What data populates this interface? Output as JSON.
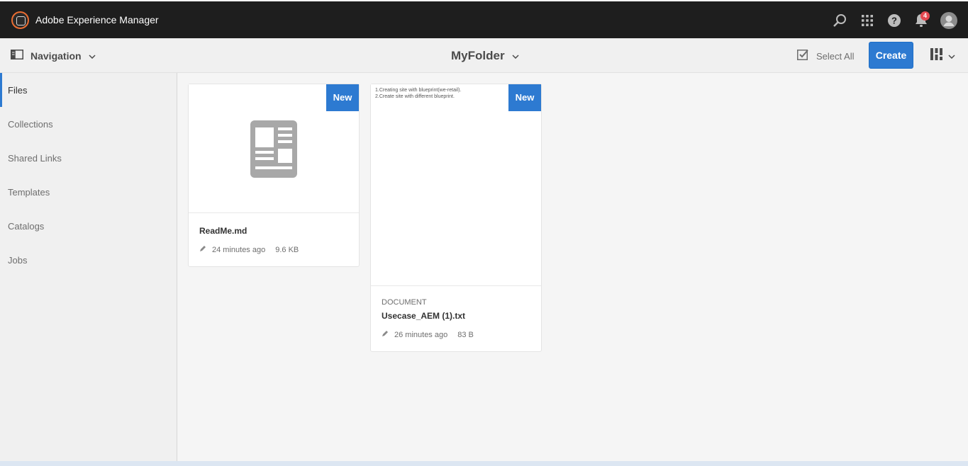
{
  "shell": {
    "app_title": "Adobe Experience Manager",
    "notification_count": "4",
    "icons": [
      "search-icon",
      "apps-grid-icon",
      "help-icon",
      "bell-icon",
      "user-avatar-icon"
    ]
  },
  "actionbar": {
    "nav_label": "Navigation",
    "folder_title": "MyFolder",
    "select_all_label": "Select All",
    "create_label": "Create"
  },
  "rail": {
    "items": [
      {
        "label": "Files",
        "active": true
      },
      {
        "label": "Collections"
      },
      {
        "label": "Shared Links"
      },
      {
        "label": "Templates"
      },
      {
        "label": "Catalogs"
      },
      {
        "label": "Jobs"
      }
    ]
  },
  "cards": [
    {
      "flag": "New",
      "name": "ReadMe.md",
      "modified": "24 minutes ago",
      "size": "9.6 KB",
      "thumbnail_icon": "document-icon"
    },
    {
      "flag": "New",
      "doc_type": "DOCUMENT",
      "name": "Usecase_AEM (1).txt",
      "modified": "26 minutes ago",
      "size": "83 B",
      "preview_lines": [
        "1.Creating site with blueprint(we-retail).",
        "2.Create site with different blueprint."
      ]
    }
  ],
  "colors": {
    "accent": "#2d7ad1",
    "shell_bg": "#1e1e1e",
    "badge": "#e34850",
    "logo_ring": "#e96d32"
  }
}
